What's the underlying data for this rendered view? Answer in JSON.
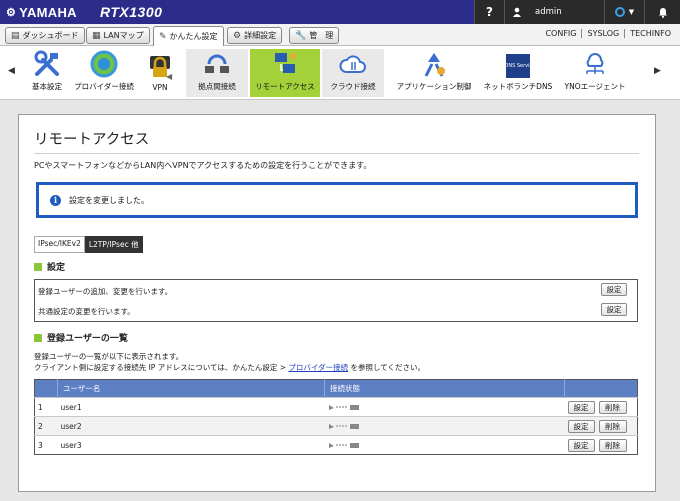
{
  "header": {
    "brand": "YAMAHA",
    "model": "RTX1300",
    "help_icon": "?",
    "username": "admin",
    "colors": {
      "topbar": "#2c2c8a",
      "accent": "#1f5bc0",
      "selected": "#a3d13a"
    }
  },
  "tabs": [
    {
      "label": "ダッシュボード",
      "icon": "dashboard-icon"
    },
    {
      "label": "LANマップ",
      "icon": "lan-map-icon"
    },
    {
      "label": "かんたん設定",
      "icon": "easy-setup-icon",
      "active": true
    },
    {
      "label": "詳細設定",
      "icon": "gear-icon"
    },
    {
      "label": "管　理",
      "icon": "wrench-icon"
    }
  ],
  "top_links": [
    "CONFIG",
    "SYSLOG",
    "TECHINFO"
  ],
  "icon_menu": [
    {
      "label": "基本設定",
      "icon": "tools-icon"
    },
    {
      "label": "プロバイダー接続",
      "icon": "globe-icon"
    },
    {
      "label": "VPN",
      "icon": "vpn-lock-icon"
    },
    {
      "label": "拠点間接続",
      "icon": "site-to-site-icon"
    },
    {
      "label": "リモートアクセス",
      "icon": "remote-access-icon",
      "selected": true
    },
    {
      "label": "クラウド接続",
      "icon": "cloud-icon"
    },
    {
      "label": "アプリケーション制御",
      "icon": "app-control-icon"
    },
    {
      "label": "ネットボランチDNS",
      "icon": "ddns-icon",
      "icon_text": "DDNS Service"
    },
    {
      "label": "YNOエージェント",
      "icon": "yno-agent-icon"
    }
  ],
  "page": {
    "title": "リモートアクセス",
    "description": "PCやスマートフォンなどからLAN内へVPNでアクセスするための設定を行うことができます。",
    "notice": "設定を変更しました。",
    "subtabs": [
      "IPsec/IKEv2",
      "L2TP/IPsec 他"
    ],
    "settings_heading": "設定",
    "settings_rows": [
      {
        "text": "登録ユーザーの追加、変更を行います。",
        "button": "設定"
      },
      {
        "text": "共通設定の変更を行います。",
        "button": "設定"
      }
    ],
    "users_heading": "登録ユーザーの一覧",
    "users_desc_1": "登録ユーザーの一覧が以下に表示されます。",
    "users_desc_2_pre": "クライアント側に設定する接続先 IP アドレスについては、かんたん設定 > ",
    "users_desc_2_link": "プロバイダー接続",
    "users_desc_2_post": " を参照してください。",
    "table": {
      "headers": [
        "",
        "ユーザー名",
        "接続状態",
        ""
      ],
      "rows": [
        {
          "num": "1",
          "user": "user1",
          "edit": "設定",
          "delete": "削除"
        },
        {
          "num": "2",
          "user": "user2",
          "edit": "設定",
          "delete": "削除"
        },
        {
          "num": "3",
          "user": "user3",
          "edit": "設定",
          "delete": "削除"
        }
      ]
    }
  }
}
